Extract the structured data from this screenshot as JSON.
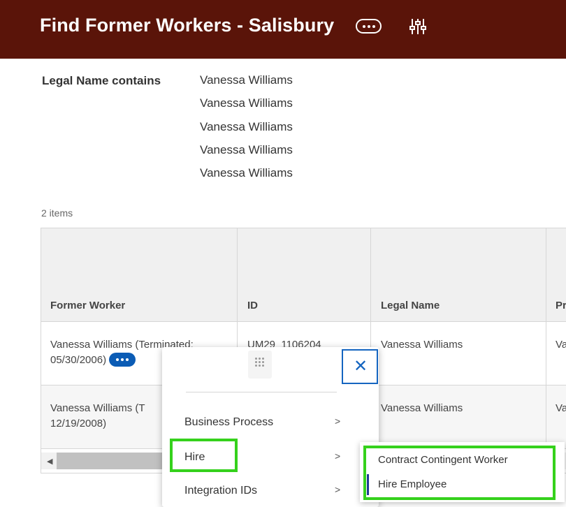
{
  "header": {
    "title": "Find Former Workers - Salisbury",
    "more_icon": "ellipsis-pill-icon",
    "filter_icon": "sliders-icon",
    "color": "#5a1409"
  },
  "facet": {
    "label": "Legal Name contains",
    "values": [
      "Vanessa Williams",
      "Vanessa Williams",
      "Vanessa Williams",
      "Vanessa Williams",
      "Vanessa Williams"
    ]
  },
  "results": {
    "count_label": "2 items",
    "columns": [
      "Former Worker",
      "ID",
      "Legal Name",
      "Pr"
    ],
    "rows": [
      {
        "worker_line1": "Vanessa Williams (Terminated:",
        "worker_line2": "05/30/2006)",
        "id": "UM29_1106204",
        "legal_name": "Vanessa Williams",
        "extra": "Va"
      },
      {
        "worker_line1": "Vanessa Williams (T",
        "worker_line2": "12/19/2008)",
        "id": "",
        "legal_name": "Vanessa Williams",
        "extra": "Va"
      }
    ]
  },
  "related_actions": {
    "close_icon": "close-icon",
    "drag_icon": "drag-handle-icon",
    "items": [
      {
        "label": "Business Process"
      },
      {
        "label": "Hire"
      },
      {
        "label": "Integration IDs"
      }
    ]
  },
  "hire_submenu": {
    "items": [
      {
        "label": "Contract Contingent Worker"
      },
      {
        "label": "Hire Employee"
      }
    ]
  },
  "colors": {
    "highlight": "#35d11c",
    "accent": "#0b5cb5"
  }
}
